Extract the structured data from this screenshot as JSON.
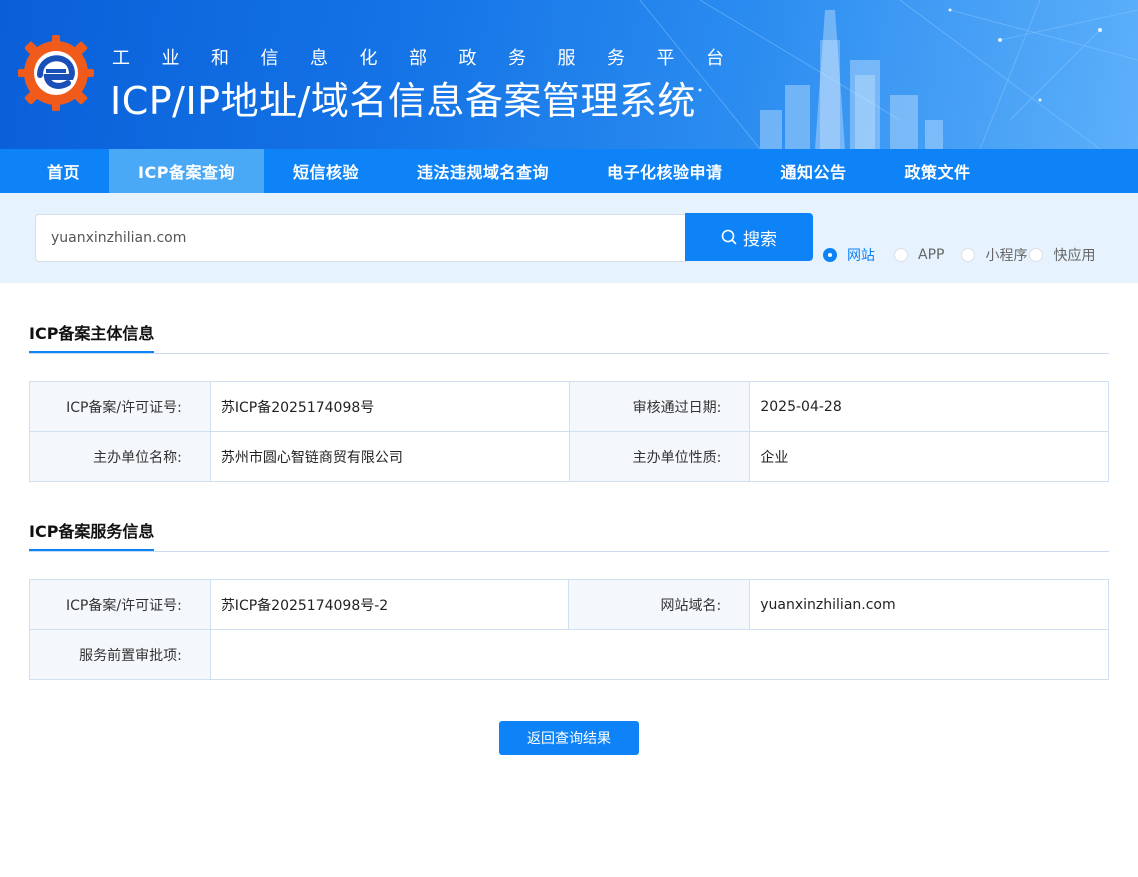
{
  "header": {
    "subtitle": "工业和信息化部政务服务平台",
    "title": "ICP/IP地址/域名信息备案管理系统"
  },
  "nav": {
    "items": [
      {
        "label": "首页",
        "active": false
      },
      {
        "label": "ICP备案查询",
        "active": true
      },
      {
        "label": "短信核验",
        "active": false
      },
      {
        "label": "违法违规域名查询",
        "active": false
      },
      {
        "label": "电子化核验申请",
        "active": false
      },
      {
        "label": "通知公告",
        "active": false
      },
      {
        "label": "政策文件",
        "active": false
      }
    ]
  },
  "search": {
    "value": "yuanxinzhilian.com",
    "button_label": "搜索",
    "options": [
      {
        "label": "网站",
        "checked": true
      },
      {
        "label": "APP",
        "checked": false
      },
      {
        "label": "小程序",
        "checked": false
      },
      {
        "label": "快应用",
        "checked": false
      }
    ]
  },
  "subject_info": {
    "title": "ICP备案主体信息",
    "rows": [
      [
        {
          "label": "ICP备案/许可证号:",
          "value": "苏ICP备2025174098号"
        },
        {
          "label": "审核通过日期:",
          "value": "2025-04-28"
        }
      ],
      [
        {
          "label": "主办单位名称:",
          "value": "苏州市圆心智链商贸有限公司"
        },
        {
          "label": "主办单位性质:",
          "value": "企业"
        }
      ]
    ]
  },
  "service_info": {
    "title": "ICP备案服务信息",
    "license_label": "ICP备案/许可证号:",
    "license_value": "苏ICP备2025174098号-2",
    "domain_label": "网站域名:",
    "domain_value": "yuanxinzhilian.com",
    "preapproval_label": "服务前置审批项:",
    "preapproval_value": ""
  },
  "back_button_label": "返回查询结果",
  "colors": {
    "primary": "#0d83f7",
    "nav_active": "#4aa9f7",
    "search_bg": "#e6f2fd",
    "logo_orange": "#f05a1a"
  }
}
